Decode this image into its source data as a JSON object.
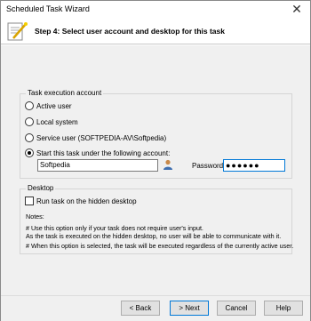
{
  "window": {
    "title": "Scheduled Task Wizard",
    "close_glyph": "✕"
  },
  "header": {
    "step_text": "Step 4: Select user account and desktop for this task",
    "icon": "wizard-icon"
  },
  "account_group": {
    "legend": "Task execution account",
    "options": [
      {
        "label": "Active user",
        "selected": false
      },
      {
        "label": "Local system",
        "selected": false
      },
      {
        "label": "Service user (SOFTPEDIA-AV\\Softpedia)",
        "selected": false
      },
      {
        "label": "Start this task under the following account:",
        "selected": true
      }
    ],
    "username_value": "Softpedia",
    "password_label": "Password:",
    "password_value": "●●●●●●"
  },
  "desktop_group": {
    "legend": "Desktop",
    "run_hidden_label": "Run task on the hidden desktop",
    "run_hidden_checked": false,
    "notes_title": "Notes:",
    "notes": [
      "# Use this option only if your task does not require user's input.",
      "As the task is executed on the hidden desktop, no user will be able to communicate with it.",
      "# When this option is selected, the task will be executed regardless of the currently active user."
    ]
  },
  "buttons": {
    "back": "< Back",
    "next": "> Next",
    "cancel": "Cancel",
    "help": "Help"
  },
  "colors": {
    "accent": "#0078d7",
    "panel": "#f0f0f0"
  }
}
